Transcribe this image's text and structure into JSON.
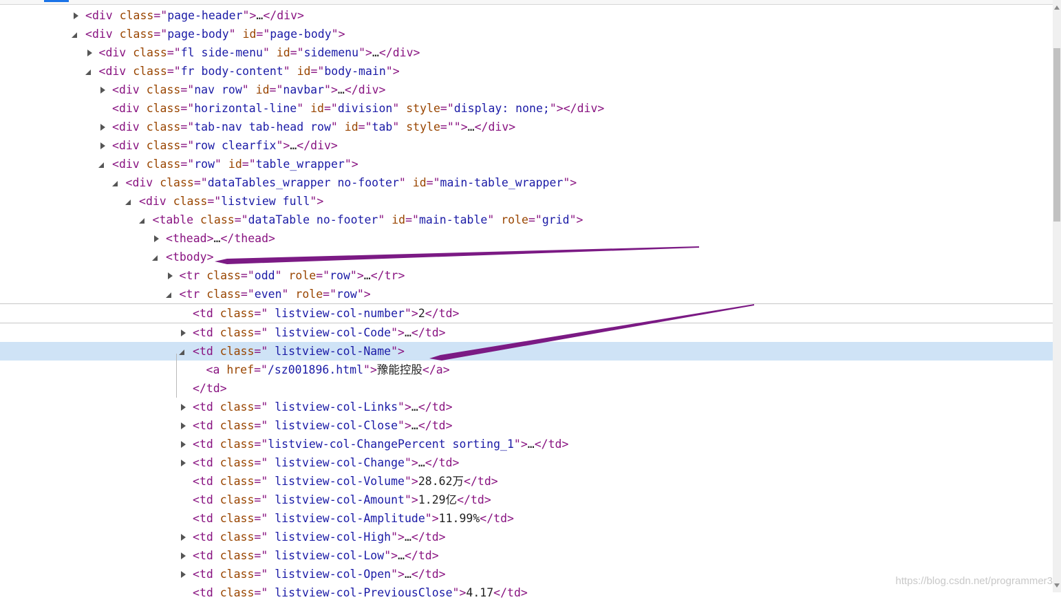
{
  "watermark": "https://blog.csdn.net/programmer3",
  "arrow_color": "#7b1a84",
  "rows": [
    {
      "name": "page-header-node",
      "depth": 0,
      "tri": "c",
      "tag": "div",
      "attrs": [
        [
          "class",
          "page-header"
        ]
      ],
      "suffix": "…</div>"
    },
    {
      "name": "page-body-node",
      "depth": 0,
      "tri": "e",
      "tag": "div",
      "attrs": [
        [
          "class",
          "page-body"
        ],
        [
          "id",
          "page-body"
        ]
      ],
      "suffix": ""
    },
    {
      "name": "side-menu-node",
      "depth": 1,
      "tri": "c",
      "tag": "div",
      "attrs": [
        [
          "class",
          "fl side-menu"
        ],
        [
          "id",
          "sidemenu"
        ]
      ],
      "suffix": "…</div>"
    },
    {
      "name": "body-content-node",
      "depth": 1,
      "tri": "e",
      "tag": "div",
      "attrs": [
        [
          "class",
          "fr body-content"
        ],
        [
          "id",
          "body-main"
        ]
      ],
      "suffix": ""
    },
    {
      "name": "navbar-node",
      "depth": 2,
      "tri": "c",
      "tag": "div",
      "attrs": [
        [
          "class",
          "nav row"
        ],
        [
          "id",
          "navbar"
        ]
      ],
      "suffix": "…</div>"
    },
    {
      "name": "division-node",
      "depth": 2,
      "tri": "",
      "tag": "div",
      "attrs": [
        [
          "class",
          "horizontal-line"
        ],
        [
          "id",
          "division"
        ],
        [
          "style",
          "display: none;"
        ]
      ],
      "suffix": "</div>"
    },
    {
      "name": "tab-node",
      "depth": 2,
      "tri": "c",
      "tag": "div",
      "attrs": [
        [
          "class",
          "tab-nav tab-head row"
        ],
        [
          "id",
          "tab"
        ],
        [
          "style",
          ""
        ]
      ],
      "suffix": "…</div>"
    },
    {
      "name": "clearfix-node",
      "depth": 2,
      "tri": "c",
      "tag": "div",
      "attrs": [
        [
          "class",
          "row clearfix"
        ]
      ],
      "suffix": "…</div>"
    },
    {
      "name": "table-wrapper-node",
      "depth": 2,
      "tri": "e",
      "tag": "div",
      "attrs": [
        [
          "class",
          "row"
        ],
        [
          "id",
          "table_wrapper"
        ]
      ],
      "suffix": ""
    },
    {
      "name": "datatables-wrapper-node",
      "depth": 3,
      "tri": "e",
      "tag": "div",
      "attrs": [
        [
          "class",
          "dataTables_wrapper no-footer"
        ],
        [
          "id",
          "main-table_wrapper"
        ]
      ],
      "suffix": ""
    },
    {
      "name": "listview-node",
      "depth": 4,
      "tri": "e",
      "tag": "div",
      "attrs": [
        [
          "class",
          "listview full"
        ]
      ],
      "suffix": ""
    },
    {
      "name": "main-table-node",
      "depth": 5,
      "tri": "e",
      "tag": "table",
      "attrs": [
        [
          "class",
          "dataTable no-footer"
        ],
        [
          "id",
          "main-table"
        ],
        [
          "role",
          "grid"
        ]
      ],
      "suffix": ""
    },
    {
      "name": "thead-node",
      "depth": 6,
      "tri": "c",
      "tag": "thead",
      "attrs": [],
      "suffix": "…</thead>"
    },
    {
      "name": "tbody-node",
      "depth": 6,
      "tri": "e",
      "tag": "tbody",
      "attrs": [],
      "suffix": ""
    },
    {
      "name": "tr-odd-node",
      "depth": 7,
      "tri": "c",
      "tag": "tr",
      "attrs": [
        [
          "class",
          "odd"
        ],
        [
          "role",
          "row"
        ]
      ],
      "suffix": "…</tr>"
    },
    {
      "name": "tr-even-node",
      "depth": 7,
      "tri": "e",
      "tag": "tr",
      "attrs": [
        [
          "class",
          "even"
        ],
        [
          "role",
          "row"
        ]
      ],
      "suffix": "",
      "bb": true
    },
    {
      "name": "td-number-node",
      "depth": 8,
      "tri": "",
      "tag": "td",
      "attrs": [
        [
          "class",
          " listview-col-number"
        ]
      ],
      "suffix": "2</td>",
      "bb": true
    },
    {
      "name": "td-code-node",
      "depth": 8,
      "tri": "c",
      "tag": "td",
      "attrs": [
        [
          "class",
          " listview-col-Code"
        ]
      ],
      "suffix": "…</td>"
    },
    {
      "name": "td-name-node",
      "depth": 8,
      "tri": "e",
      "tag": "td",
      "attrs": [
        [
          "class",
          " listview-col-Name"
        ]
      ],
      "suffix": "",
      "sel": true
    },
    {
      "name": "a-link-node",
      "depth": 9,
      "tri": "",
      "tag": "a",
      "attrs": [
        [
          "href",
          "/sz001896.html"
        ]
      ],
      "suffix": "豫能控股</a>"
    },
    {
      "name": "td-close-tag",
      "depth": 8,
      "tri": "",
      "raw": "</td>"
    },
    {
      "name": "td-links-node",
      "depth": 8,
      "tri": "c",
      "tag": "td",
      "attrs": [
        [
          "class",
          " listview-col-Links"
        ]
      ],
      "suffix": "…</td>"
    },
    {
      "name": "td-close-col-node",
      "depth": 8,
      "tri": "c",
      "tag": "td",
      "attrs": [
        [
          "class",
          " listview-col-Close"
        ]
      ],
      "suffix": "…</td>"
    },
    {
      "name": "td-changepercent-node",
      "depth": 8,
      "tri": "c",
      "tag": "td",
      "attrs": [
        [
          "class",
          "listview-col-ChangePercent sorting_1"
        ]
      ],
      "suffix": "…</td>"
    },
    {
      "name": "td-change-node",
      "depth": 8,
      "tri": "c",
      "tag": "td",
      "attrs": [
        [
          "class",
          " listview-col-Change"
        ]
      ],
      "suffix": "…</td>"
    },
    {
      "name": "td-volume-node",
      "depth": 8,
      "tri": "",
      "tag": "td",
      "attrs": [
        [
          "class",
          " listview-col-Volume"
        ]
      ],
      "suffix": "28.62万</td>"
    },
    {
      "name": "td-amount-node",
      "depth": 8,
      "tri": "",
      "tag": "td",
      "attrs": [
        [
          "class",
          " listview-col-Amount"
        ]
      ],
      "suffix": "1.29亿</td>"
    },
    {
      "name": "td-amplitude-node",
      "depth": 8,
      "tri": "",
      "tag": "td",
      "attrs": [
        [
          "class",
          " listview-col-Amplitude"
        ]
      ],
      "suffix": "11.99%</td>"
    },
    {
      "name": "td-high-node",
      "depth": 8,
      "tri": "c",
      "tag": "td",
      "attrs": [
        [
          "class",
          " listview-col-High"
        ]
      ],
      "suffix": "…</td>"
    },
    {
      "name": "td-low-node",
      "depth": 8,
      "tri": "c",
      "tag": "td",
      "attrs": [
        [
          "class",
          " listview-col-Low"
        ]
      ],
      "suffix": "…</td>"
    },
    {
      "name": "td-open-node",
      "depth": 8,
      "tri": "c",
      "tag": "td",
      "attrs": [
        [
          "class",
          " listview-col-Open"
        ]
      ],
      "suffix": "…</td>"
    },
    {
      "name": "td-previousclose-node",
      "depth": 8,
      "tri": "",
      "tag": "td",
      "attrs": [
        [
          "class",
          " listview-col-PreviousClose"
        ]
      ],
      "suffix": "4.17</td>"
    }
  ]
}
